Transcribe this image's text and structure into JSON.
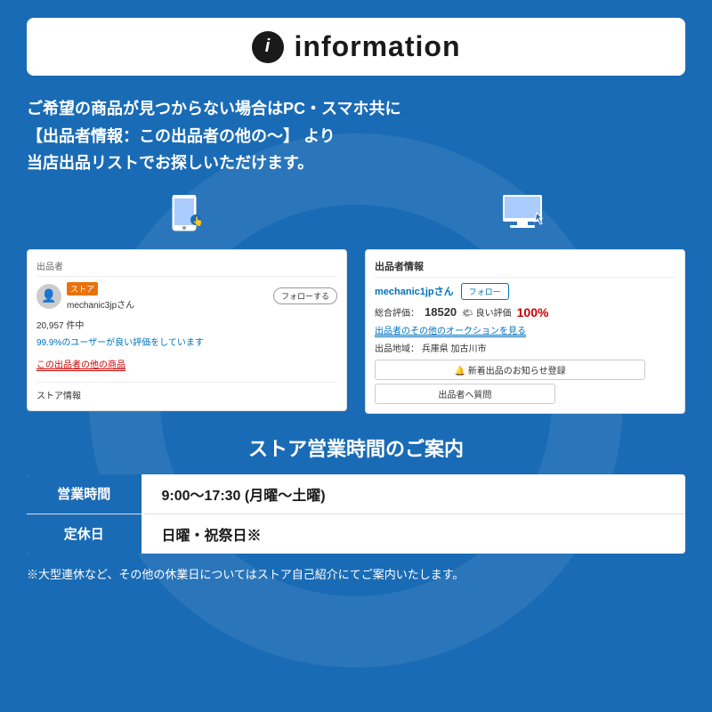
{
  "header": {
    "title": "information",
    "icon_char": "i"
  },
  "main_text": {
    "line1": "ご希望の商品が見つからない場合はPC・スマホ共に",
    "line2": "【出品者情報：この出品者の他の〜】 より",
    "line3": "当店出品リストでお探しいただけます。"
  },
  "mobile_screenshot": {
    "seller_label": "出品者",
    "store_badge": "ストア",
    "seller_name": "mechanic3jpさん",
    "follow_btn": "フォローする",
    "stats": "20,957 件中",
    "rating_text": "99.9%のユーザーが良い評価をしています",
    "other_items_link": "この出品者の他の商品",
    "store_info": "ストア情報"
  },
  "desktop_screenshot": {
    "label": "出品者情報",
    "seller_name": "mechanic1jpさん",
    "follow_btn": "フォロー",
    "rating_label": "総合評価：",
    "rating_num": "18520",
    "good_label": "🌤 良い評価",
    "good_pct": "100%",
    "auction_link": "出品者のその他のオークションを見る",
    "location_label": "出品地域：",
    "location": "兵庫県 加古川市",
    "notify_btn": "🔔 新着出品のお知らせ登録",
    "question_btn": "出品者へ質問"
  },
  "store_hours": {
    "title": "ストア営業時間のご案内",
    "rows": [
      {
        "label": "営業時間",
        "value": "9:00〜17:30 (月曜〜土曜)"
      },
      {
        "label": "定休日",
        "value": "日曜・祝祭日※"
      }
    ],
    "footer_note": "※大型連休など、その他の休業日についてはストア自己紹介にてご案内いたします。"
  },
  "colors": {
    "primary_blue": "#1a6bb5",
    "white": "#ffffff",
    "dark": "#1a1a1a",
    "red": "#cc0000",
    "link_blue": "#0072bc"
  }
}
